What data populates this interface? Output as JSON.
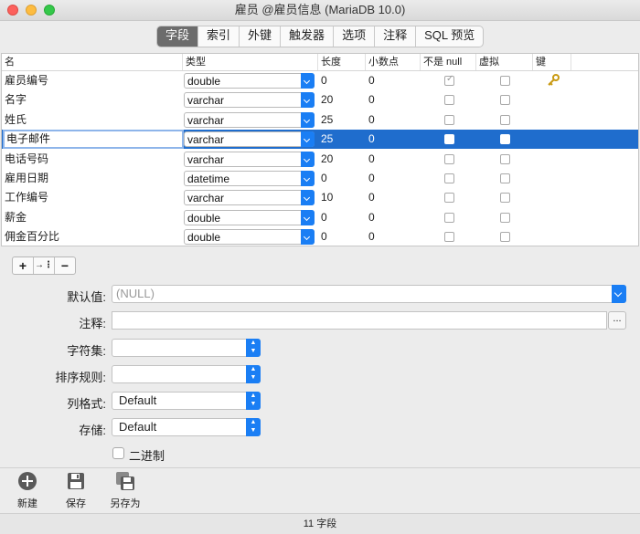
{
  "window": {
    "title": "雇员 @雇员信息 (MariaDB 10.0)"
  },
  "tabs": [
    "字段",
    "索引",
    "外键",
    "触发器",
    "选项",
    "注释",
    "SQL 预览"
  ],
  "columns": {
    "name": "名",
    "type": "类型",
    "length": "长度",
    "decimals": "小数点",
    "not_null": "不是 null",
    "virtual": "虚拟",
    "key": "键"
  },
  "rows": [
    {
      "name": "雇员编号",
      "type": "double",
      "length": "0",
      "decimals": "0",
      "not_null": true,
      "virtual": false,
      "key": "key-icon"
    },
    {
      "name": "名字",
      "type": "varchar",
      "length": "20",
      "decimals": "0",
      "not_null": false,
      "virtual": false
    },
    {
      "name": "姓氏",
      "type": "varchar",
      "length": "25",
      "decimals": "0",
      "not_null": false,
      "virtual": false
    },
    {
      "name": "电子邮件",
      "type": "varchar",
      "length": "25",
      "decimals": "0",
      "not_null": false,
      "virtual": false,
      "selected": true
    },
    {
      "name": "电话号码",
      "type": "varchar",
      "length": "20",
      "decimals": "0",
      "not_null": false,
      "virtual": false
    },
    {
      "name": "雇用日期",
      "type": "datetime",
      "length": "0",
      "decimals": "0",
      "not_null": false,
      "virtual": false
    },
    {
      "name": "工作编号",
      "type": "varchar",
      "length": "10",
      "decimals": "0",
      "not_null": false,
      "virtual": false
    },
    {
      "name": "薪金",
      "type": "double",
      "length": "0",
      "decimals": "0",
      "not_null": false,
      "virtual": false
    },
    {
      "name": "佣金百分比",
      "type": "double",
      "length": "0",
      "decimals": "0",
      "not_null": false,
      "virtual": false
    }
  ],
  "toolbar": {
    "add": "+",
    "insert": "→⋮",
    "remove": "−"
  },
  "props": {
    "default_label": "默认值:",
    "default_placeholder": "(NULL)",
    "comment_label": "注释:",
    "comment_value": "",
    "comment_more": "...",
    "charset_label": "字符集:",
    "charset_value": "",
    "collation_label": "排序规则:",
    "collation_value": "",
    "colformat_label": "列格式:",
    "colformat_value": "Default",
    "storage_label": "存储:",
    "storage_value": "Default",
    "binary_label": "二进制",
    "binary_checked": false
  },
  "footer": {
    "new": "新建",
    "save": "保存",
    "save_as": "另存为"
  },
  "status": "11 字段",
  "colors": {
    "accent": "#1a7ef4",
    "selection": "#1f6dcd"
  }
}
